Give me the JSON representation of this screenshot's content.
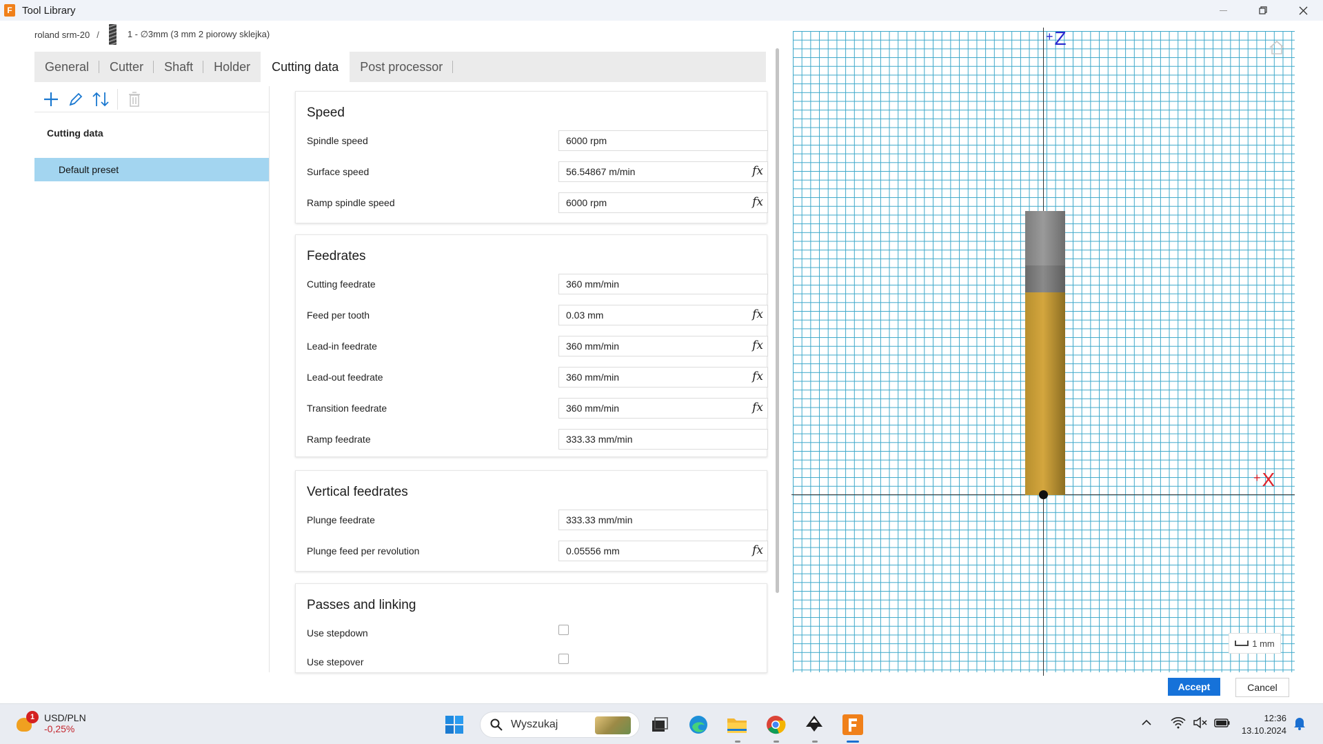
{
  "window": {
    "title": "Tool Library",
    "app_icon_letter": "F"
  },
  "breadcrumb": {
    "machine": "roland srm-20",
    "separator": "/",
    "tool": "1 - ∅3mm (3 mm 2 piorowy sklejka)"
  },
  "tabs": [
    {
      "label": "General"
    },
    {
      "label": "Cutter"
    },
    {
      "label": "Shaft"
    },
    {
      "label": "Holder"
    },
    {
      "label": "Cutting data"
    },
    {
      "label": "Post processor"
    }
  ],
  "active_tab": "Cutting data",
  "left_panel": {
    "header": "Cutting data",
    "items": [
      {
        "label": "Default preset"
      }
    ]
  },
  "sections": {
    "speed": {
      "title": "Speed",
      "rows": [
        {
          "label": "Spindle speed",
          "value": "6000 rpm",
          "fx": ""
        },
        {
          "label": "Surface speed",
          "value": "56.54867 m/min",
          "fx": "fx"
        },
        {
          "label": "Ramp spindle speed",
          "value": "6000 rpm",
          "fx": "fx"
        }
      ]
    },
    "feedrates": {
      "title": "Feedrates",
      "rows": [
        {
          "label": "Cutting feedrate",
          "value": "360 mm/min",
          "fx": ""
        },
        {
          "label": "Feed per tooth",
          "value": "0.03 mm",
          "fx": "fx"
        },
        {
          "label": "Lead-in feedrate",
          "value": "360 mm/min",
          "fx": "fx"
        },
        {
          "label": "Lead-out feedrate",
          "value": "360 mm/min",
          "fx": "fx"
        },
        {
          "label": "Transition feedrate",
          "value": "360 mm/min",
          "fx": "fx"
        },
        {
          "label": "Ramp feedrate",
          "value": "333.33 mm/min",
          "fx": ""
        }
      ]
    },
    "vertical": {
      "title": "Vertical feedrates",
      "rows": [
        {
          "label": "Plunge feedrate",
          "value": "333.33 mm/min",
          "fx": ""
        },
        {
          "label": "Plunge feed per revolution",
          "value": "0.05556 mm",
          "fx": "fx"
        }
      ]
    },
    "passes": {
      "title": "Passes and linking",
      "rows": [
        {
          "label": "Use stepdown"
        },
        {
          "label": "Use stepover"
        }
      ]
    }
  },
  "viewer": {
    "z_axis_label": "Z",
    "x_axis_label": "X",
    "plus": "+",
    "scale_label": "1 mm",
    "z_color": "#2a2ad0",
    "x_color": "#e0242c",
    "grid_color": "#3aa7c9",
    "cutter_color": "#d4a63e",
    "shaft_color": "#8a8a8a"
  },
  "buttons": {
    "accept": "Accept",
    "cancel": "Cancel",
    "accent": "#1672d9"
  },
  "taskbar": {
    "widget_title": "USD/PLN",
    "widget_change": "-0,25%",
    "widget_badge": "1",
    "search_placeholder": "Wyszukaj",
    "time": "12:36",
    "date": "13.10.2024"
  }
}
